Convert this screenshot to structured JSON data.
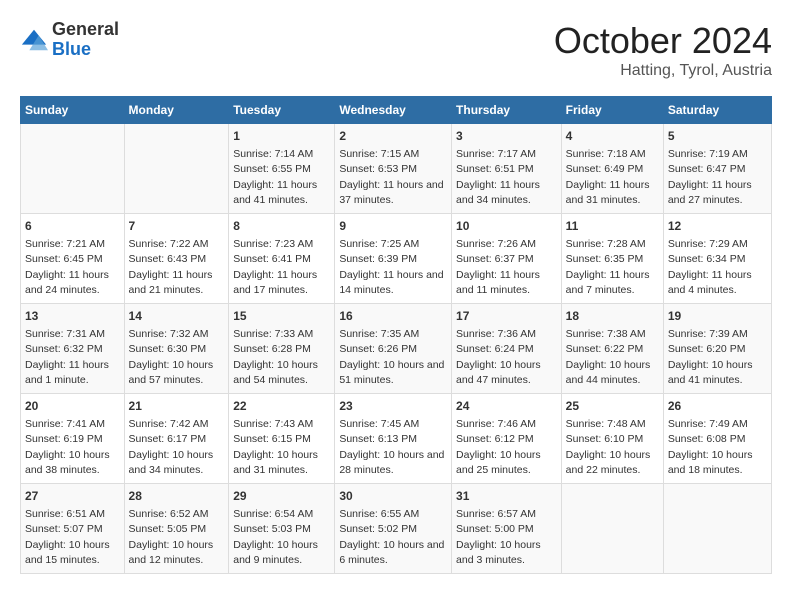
{
  "header": {
    "logo_general": "General",
    "logo_blue": "Blue",
    "title": "October 2024",
    "location": "Hatting, Tyrol, Austria"
  },
  "columns": [
    "Sunday",
    "Monday",
    "Tuesday",
    "Wednesday",
    "Thursday",
    "Friday",
    "Saturday"
  ],
  "weeks": [
    [
      {
        "day": "",
        "info": ""
      },
      {
        "day": "",
        "info": ""
      },
      {
        "day": "1",
        "info": "Sunrise: 7:14 AM\nSunset: 6:55 PM\nDaylight: 11 hours and 41 minutes."
      },
      {
        "day": "2",
        "info": "Sunrise: 7:15 AM\nSunset: 6:53 PM\nDaylight: 11 hours and 37 minutes."
      },
      {
        "day": "3",
        "info": "Sunrise: 7:17 AM\nSunset: 6:51 PM\nDaylight: 11 hours and 34 minutes."
      },
      {
        "day": "4",
        "info": "Sunrise: 7:18 AM\nSunset: 6:49 PM\nDaylight: 11 hours and 31 minutes."
      },
      {
        "day": "5",
        "info": "Sunrise: 7:19 AM\nSunset: 6:47 PM\nDaylight: 11 hours and 27 minutes."
      }
    ],
    [
      {
        "day": "6",
        "info": "Sunrise: 7:21 AM\nSunset: 6:45 PM\nDaylight: 11 hours and 24 minutes."
      },
      {
        "day": "7",
        "info": "Sunrise: 7:22 AM\nSunset: 6:43 PM\nDaylight: 11 hours and 21 minutes."
      },
      {
        "day": "8",
        "info": "Sunrise: 7:23 AM\nSunset: 6:41 PM\nDaylight: 11 hours and 17 minutes."
      },
      {
        "day": "9",
        "info": "Sunrise: 7:25 AM\nSunset: 6:39 PM\nDaylight: 11 hours and 14 minutes."
      },
      {
        "day": "10",
        "info": "Sunrise: 7:26 AM\nSunset: 6:37 PM\nDaylight: 11 hours and 11 minutes."
      },
      {
        "day": "11",
        "info": "Sunrise: 7:28 AM\nSunset: 6:35 PM\nDaylight: 11 hours and 7 minutes."
      },
      {
        "day": "12",
        "info": "Sunrise: 7:29 AM\nSunset: 6:34 PM\nDaylight: 11 hours and 4 minutes."
      }
    ],
    [
      {
        "day": "13",
        "info": "Sunrise: 7:31 AM\nSunset: 6:32 PM\nDaylight: 11 hours and 1 minute."
      },
      {
        "day": "14",
        "info": "Sunrise: 7:32 AM\nSunset: 6:30 PM\nDaylight: 10 hours and 57 minutes."
      },
      {
        "day": "15",
        "info": "Sunrise: 7:33 AM\nSunset: 6:28 PM\nDaylight: 10 hours and 54 minutes."
      },
      {
        "day": "16",
        "info": "Sunrise: 7:35 AM\nSunset: 6:26 PM\nDaylight: 10 hours and 51 minutes."
      },
      {
        "day": "17",
        "info": "Sunrise: 7:36 AM\nSunset: 6:24 PM\nDaylight: 10 hours and 47 minutes."
      },
      {
        "day": "18",
        "info": "Sunrise: 7:38 AM\nSunset: 6:22 PM\nDaylight: 10 hours and 44 minutes."
      },
      {
        "day": "19",
        "info": "Sunrise: 7:39 AM\nSunset: 6:20 PM\nDaylight: 10 hours and 41 minutes."
      }
    ],
    [
      {
        "day": "20",
        "info": "Sunrise: 7:41 AM\nSunset: 6:19 PM\nDaylight: 10 hours and 38 minutes."
      },
      {
        "day": "21",
        "info": "Sunrise: 7:42 AM\nSunset: 6:17 PM\nDaylight: 10 hours and 34 minutes."
      },
      {
        "day": "22",
        "info": "Sunrise: 7:43 AM\nSunset: 6:15 PM\nDaylight: 10 hours and 31 minutes."
      },
      {
        "day": "23",
        "info": "Sunrise: 7:45 AM\nSunset: 6:13 PM\nDaylight: 10 hours and 28 minutes."
      },
      {
        "day": "24",
        "info": "Sunrise: 7:46 AM\nSunset: 6:12 PM\nDaylight: 10 hours and 25 minutes."
      },
      {
        "day": "25",
        "info": "Sunrise: 7:48 AM\nSunset: 6:10 PM\nDaylight: 10 hours and 22 minutes."
      },
      {
        "day": "26",
        "info": "Sunrise: 7:49 AM\nSunset: 6:08 PM\nDaylight: 10 hours and 18 minutes."
      }
    ],
    [
      {
        "day": "27",
        "info": "Sunrise: 6:51 AM\nSunset: 5:07 PM\nDaylight: 10 hours and 15 minutes."
      },
      {
        "day": "28",
        "info": "Sunrise: 6:52 AM\nSunset: 5:05 PM\nDaylight: 10 hours and 12 minutes."
      },
      {
        "day": "29",
        "info": "Sunrise: 6:54 AM\nSunset: 5:03 PM\nDaylight: 10 hours and 9 minutes."
      },
      {
        "day": "30",
        "info": "Sunrise: 6:55 AM\nSunset: 5:02 PM\nDaylight: 10 hours and 6 minutes."
      },
      {
        "day": "31",
        "info": "Sunrise: 6:57 AM\nSunset: 5:00 PM\nDaylight: 10 hours and 3 minutes."
      },
      {
        "day": "",
        "info": ""
      },
      {
        "day": "",
        "info": ""
      }
    ]
  ]
}
